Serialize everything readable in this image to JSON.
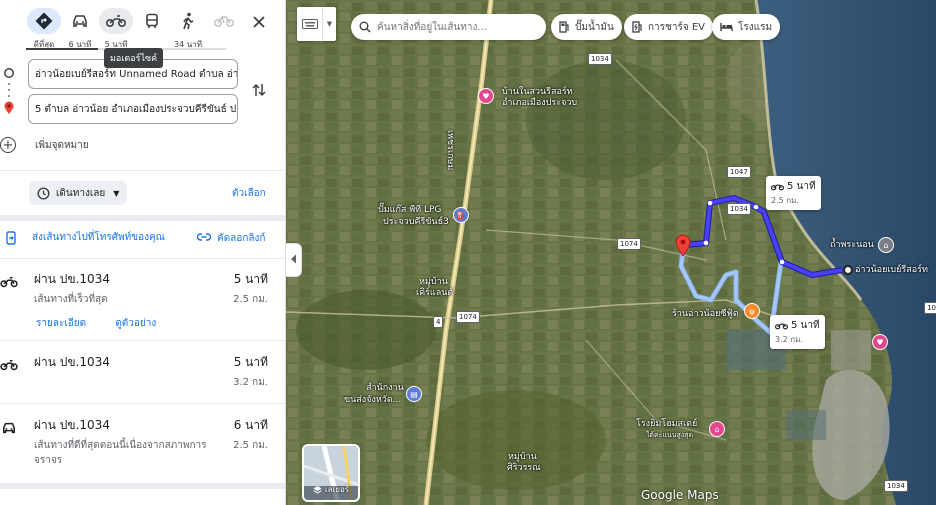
{
  "modes": [
    {
      "label": "ดีที่สุด",
      "icon": "directions-icon"
    },
    {
      "label": "6 นาที",
      "icon": "car-icon"
    },
    {
      "label": "5 นาที",
      "icon": "motorcycle-icon"
    },
    {
      "label": "",
      "icon": "transit-icon"
    },
    {
      "label": "34 นาที",
      "icon": "walk-icon"
    },
    {
      "label": "",
      "icon": "bicycle-icon"
    }
  ],
  "tooltip": "มอเตอร์ไซค์",
  "origin": "อ่าวน้อยเบย์รีสอร์ท Unnamed Road ตำบล อ่าวน้อย",
  "destination": "5 ตำบล อ่าวน้อย อำเภอเมืองประจวบคีรีขันธ์ ประจวบคีรีขันธ์",
  "add_destination": "เพิ่มจุดหมาย",
  "leave_now": "เดินทางเลย",
  "options": "ตัวเลือก",
  "send_to_phone": "ส่งเส้นทางไปที่โทรศัพท์ของคุณ",
  "copy_link": "คัดลอกลิงก์",
  "routes": [
    {
      "name": "ผ่าน ปข.1034",
      "desc": "เส้นทางที่เร็วที่สุด",
      "duration": "5 นาที",
      "distance": "2.5 กม.",
      "vehicle": "motorcycle",
      "details": "รายละเอียด",
      "preview": "ดูตัวอย่าง"
    },
    {
      "name": "ผ่าน ปข.1034",
      "desc": "",
      "duration": "5 นาที",
      "distance": "3.2 กม.",
      "vehicle": "motorcycle"
    },
    {
      "name": "ผ่าน ปข.1034",
      "desc": "เส้นทางที่ดีที่สุดตอนนี้เนื่องจากสภาพการจราจร",
      "duration": "6 นาที",
      "distance": "2.5 กม.",
      "vehicle": "car"
    }
  ],
  "map": {
    "search_placeholder": "ค้นหาสิ่งที่อยู่ในเส้นทาง...",
    "chips": [
      "ปั๊มน้ำมัน",
      "การชาร์จ EV",
      "โรงแรม"
    ],
    "labels": {
      "resort_name": "บ้านในสวนรีสอร์ท",
      "resort_sub": "อำเภอเมืองประจวบ",
      "petrol_1": "ปั๊มแก๊ส พีที LPG",
      "petrol_2": "ประจวบคีรีขันธ์3",
      "village_1a": "หมู่บ้าน",
      "village_1b": "เคิร์แลนด์",
      "office_1": "สำนักงาน",
      "office_2": "ขนส่งจังหวัด...",
      "cave": "ถ้ำพระนอน",
      "shop": "ร้านอ่าวน้อยซีฟู้ด",
      "bay": "อ่าวน้อยเบย์รีสอร์ท",
      "pool_1": "โรงยิมโฮมสเตย์",
      "pool_2": "ใต้คะแนนสูงสุด",
      "village_2a": "หมู่บ้าน",
      "village_2b": "ศิริวรรณ",
      "road_vertical": "เพชรเกษม"
    },
    "route_boxes": [
      {
        "time": "5 นาที",
        "dist": "2.5 กม."
      },
      {
        "time": "5 นาที",
        "dist": "3.2 กม."
      }
    ],
    "shields": [
      "1034",
      "1047",
      "1034",
      "1074",
      "1074",
      "4",
      "1034",
      "1034"
    ],
    "layers": "เลเยอร์",
    "brand": "Google Maps"
  }
}
